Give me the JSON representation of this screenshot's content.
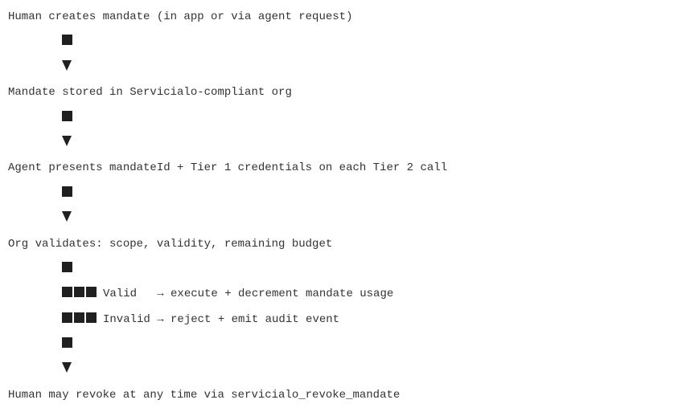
{
  "steps": [
    "Human creates mandate (in app or via agent request)",
    "Mandate stored in Servicialo-compliant org",
    "Agent presents mandateId + Tier 1 credentials on each Tier 2 call",
    "Org validates: scope, validity, remaining budget",
    "Human may revoke at any time via servicialo_revoke_mandate"
  ],
  "branches": [
    "Valid   → execute + decrement mandate usage",
    "Invalid → reject + emit audit event"
  ]
}
